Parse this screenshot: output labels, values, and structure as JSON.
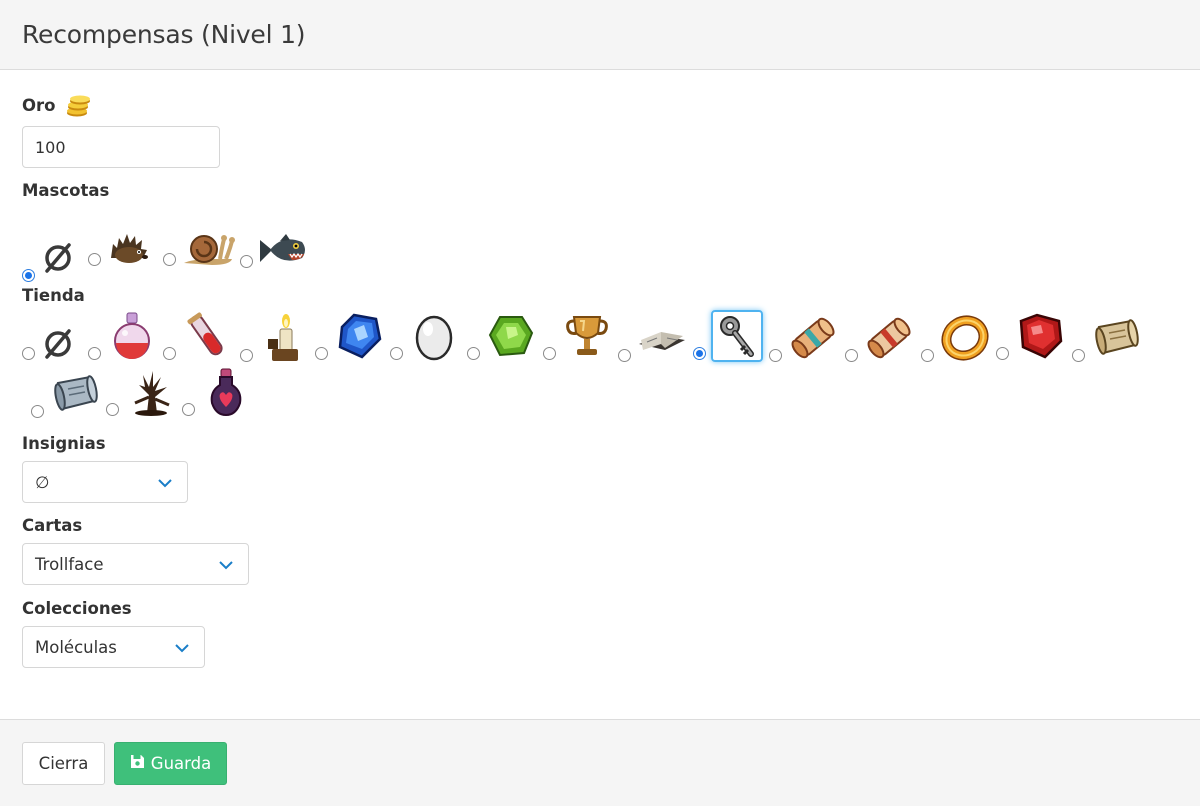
{
  "dialog": {
    "title": "Recompensas (Nivel 1)"
  },
  "gold": {
    "label": "Oro",
    "value": "100",
    "icon": "gold-coins-icon"
  },
  "pets": {
    "label": "Mascotas",
    "options": [
      {
        "name": "none",
        "glyph": "∅",
        "checked": true
      },
      {
        "name": "hedgehog-icon",
        "checked": false
      },
      {
        "name": "snail-icon",
        "checked": false
      },
      {
        "name": "piranha-icon",
        "checked": false
      }
    ]
  },
  "shop": {
    "label": "Tienda",
    "options": [
      {
        "name": "none",
        "glyph": "∅",
        "checked": false
      },
      {
        "name": "red-potion-icon",
        "checked": false
      },
      {
        "name": "test-tube-icon",
        "checked": false
      },
      {
        "name": "candle-icon",
        "checked": false
      },
      {
        "name": "blue-gem-icon",
        "checked": false
      },
      {
        "name": "egg-icon",
        "checked": false
      },
      {
        "name": "green-gem-icon",
        "checked": false
      },
      {
        "name": "trophy-icon",
        "checked": false
      },
      {
        "name": "open-book-icon",
        "checked": false
      },
      {
        "name": "key-icon",
        "checked": true
      },
      {
        "name": "scroll-blue-icon",
        "checked": false
      },
      {
        "name": "scroll-red-icon",
        "checked": false
      },
      {
        "name": "gold-ring-icon",
        "checked": false
      },
      {
        "name": "ruby-icon",
        "checked": false
      },
      {
        "name": "parchment-icon",
        "checked": false
      },
      {
        "name": "stone-scroll-icon",
        "checked": false
      },
      {
        "name": "dead-tree-icon",
        "checked": false
      },
      {
        "name": "heart-flask-icon",
        "checked": false
      }
    ]
  },
  "badges": {
    "label": "Insignias",
    "selected": "∅"
  },
  "cards": {
    "label": "Cartas",
    "selected": "Trollface"
  },
  "collections": {
    "label": "Colecciones",
    "selected": "Moléculas"
  },
  "footer": {
    "close_label": "Cierra",
    "save_label": "Guarda"
  },
  "colors": {
    "primary_save": "#3fc07b",
    "radio_checked": "#1a73e8",
    "selection_glow": "#4fb3f0"
  }
}
